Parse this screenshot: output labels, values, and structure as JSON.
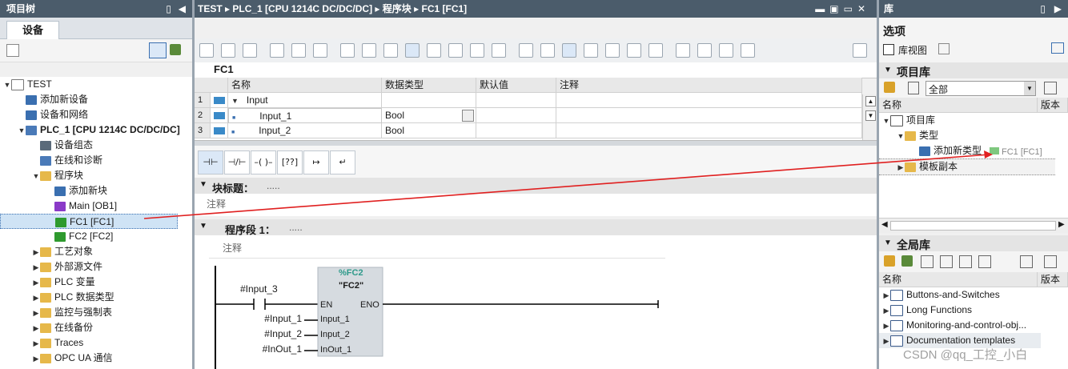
{
  "left_panel": {
    "title": "项目树",
    "tab": "设备",
    "tree": [
      {
        "label": "TEST",
        "indent": 0,
        "toggle": "▼",
        "icon": "project-icon"
      },
      {
        "label": "添加新设备",
        "indent": 1,
        "toggle": "",
        "icon": "add-device-icon"
      },
      {
        "label": "设备和网络",
        "indent": 1,
        "toggle": "",
        "icon": "network-icon"
      },
      {
        "label": "PLC_1 [CPU 1214C DC/DC/DC]",
        "indent": 1,
        "toggle": "▼",
        "icon": "plc-icon",
        "bold": true
      },
      {
        "label": "设备组态",
        "indent": 2,
        "toggle": "",
        "icon": "device-config-icon"
      },
      {
        "label": "在线和诊断",
        "indent": 2,
        "toggle": "",
        "icon": "diagnostics-icon"
      },
      {
        "label": "程序块",
        "indent": 2,
        "toggle": "▼",
        "icon": "folder-icon"
      },
      {
        "label": "添加新块",
        "indent": 3,
        "toggle": "",
        "icon": "add-block-icon"
      },
      {
        "label": "Main [OB1]",
        "indent": 3,
        "toggle": "",
        "icon": "ob-icon"
      },
      {
        "label": "FC1 [FC1]",
        "indent": 3,
        "toggle": "",
        "icon": "fc-icon",
        "selected": true
      },
      {
        "label": "FC2 [FC2]",
        "indent": 3,
        "toggle": "",
        "icon": "fc-icon"
      },
      {
        "label": "工艺对象",
        "indent": 2,
        "toggle": "▶",
        "icon": "folder-icon"
      },
      {
        "label": "外部源文件",
        "indent": 2,
        "toggle": "▶",
        "icon": "folder-icon"
      },
      {
        "label": "PLC 变量",
        "indent": 2,
        "toggle": "▶",
        "icon": "folder-icon"
      },
      {
        "label": "PLC 数据类型",
        "indent": 2,
        "toggle": "▶",
        "icon": "folder-icon"
      },
      {
        "label": "监控与强制表",
        "indent": 2,
        "toggle": "▶",
        "icon": "folder-icon"
      },
      {
        "label": "在线备份",
        "indent": 2,
        "toggle": "▶",
        "icon": "folder-icon"
      },
      {
        "label": "Traces",
        "indent": 2,
        "toggle": "▶",
        "icon": "folder-icon"
      },
      {
        "label": "OPC UA 通信",
        "indent": 2,
        "toggle": "▶",
        "icon": "folder-icon"
      }
    ]
  },
  "editor": {
    "breadcrumb": [
      "TEST",
      "PLC_1 [CPU 1214C DC/DC/DC]",
      "程序块",
      "FC1 [FC1]"
    ],
    "block_name": "FC1",
    "interface_headers": [
      "名称",
      "数据类型",
      "默认值",
      "注释"
    ],
    "interface_rows": [
      {
        "num": "1",
        "name": "Input",
        "type": "",
        "toggle": "▼"
      },
      {
        "num": "2",
        "name": "Input_1",
        "type": "Bool",
        "toggle": ""
      },
      {
        "num": "3",
        "name": "Input_2",
        "type": "Bool",
        "toggle": ""
      }
    ],
    "block_title_label": "块标题：",
    "block_title_value": ".....",
    "comment": "注释",
    "network_label": "程序段 1：",
    "network_value": ".....",
    "network_comment": "注释",
    "ladder": {
      "contact_tag": "#Input_3",
      "box_instance": "%FC2",
      "box_name": "\"FC2\"",
      "en": "EN",
      "eno": "ENO",
      "params": [
        {
          "arg": "#Input_1",
          "pin": "Input_1"
        },
        {
          "arg": "#Input_2",
          "pin": "Input_2"
        },
        {
          "arg": "#InOut_1",
          "pin": "InOut_1"
        }
      ]
    }
  },
  "right_panel": {
    "title": "库",
    "options": "选项",
    "library_view": "库视图",
    "project_library": "项目库",
    "filter": "全部",
    "col_name": "名称",
    "col_version": "版本",
    "project_tree": [
      {
        "label": "项目库",
        "indent": 0,
        "toggle": "▼"
      },
      {
        "label": "类型",
        "indent": 1,
        "toggle": "▼"
      },
      {
        "label": "添加新类型",
        "indent": 2,
        "toggle": ""
      },
      {
        "label": "模板副本",
        "indent": 1,
        "toggle": "▶"
      }
    ],
    "drag_ghost": "FC1 [FC1]",
    "global_library": "全局库",
    "global_items": [
      "Buttons-and-Switches",
      "Long Functions",
      "Monitoring-and-control-obj...",
      "Documentation templates"
    ]
  },
  "watermark": "CSDN @qq_工控_小白",
  "colors": {
    "header": "#4b5c6b",
    "accent": "#3a6fb0",
    "arrow": "#e02020",
    "fc_green": "#2e9a2e"
  }
}
